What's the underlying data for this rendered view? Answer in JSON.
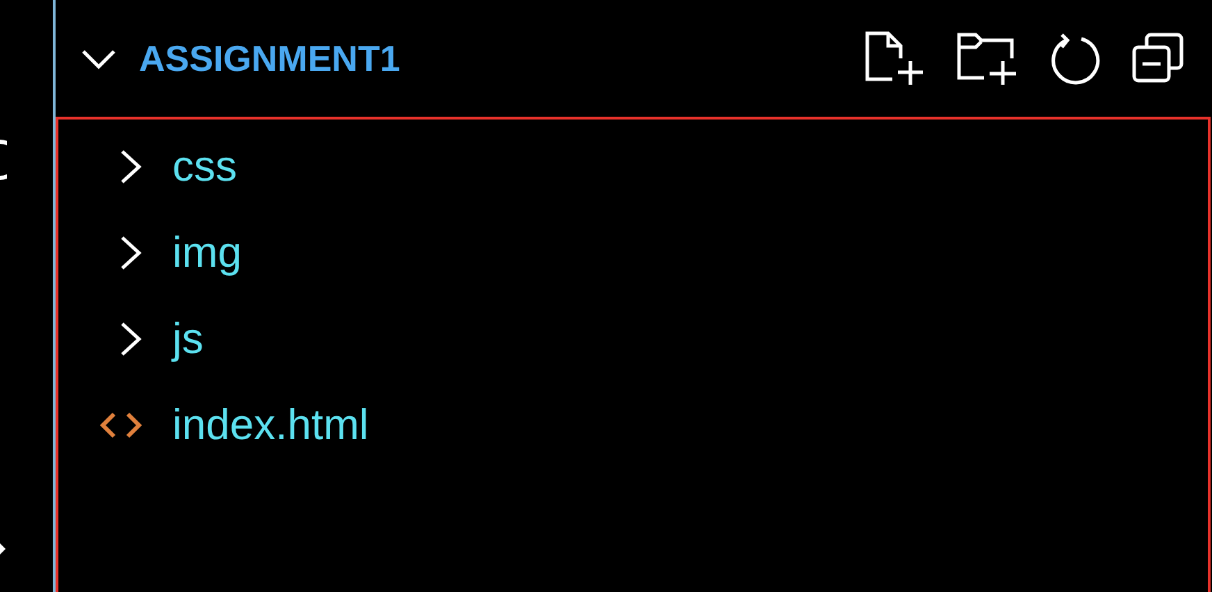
{
  "explorer": {
    "title": "ASSIGNMENT1",
    "expanded": true,
    "items": [
      {
        "kind": "folder",
        "label": "css",
        "expanded": false
      },
      {
        "kind": "folder",
        "label": "img",
        "expanded": false
      },
      {
        "kind": "folder",
        "label": "js",
        "expanded": false
      },
      {
        "kind": "file",
        "label": "index.html"
      }
    ]
  }
}
